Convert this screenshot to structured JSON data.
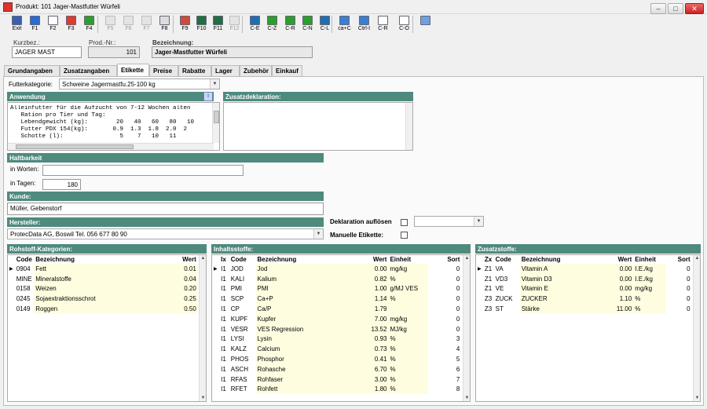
{
  "window": {
    "title": "Produkt: 101 Jager-Mastfutter Würfeli"
  },
  "toolbar": [
    {
      "label": "Exit",
      "icon": "exit-icon",
      "color": "#3a5fb0",
      "enabled": true
    },
    {
      "label": "F1",
      "icon": "help-icon",
      "color": "#2a6bd1",
      "enabled": true
    },
    {
      "label": "F2",
      "icon": "new-document-icon",
      "color": "#ffffff",
      "enabled": true
    },
    {
      "label": "F3",
      "icon": "delete-icon",
      "color": "#e03a2a",
      "enabled": true
    },
    {
      "label": "F4",
      "icon": "save-icon",
      "color": "#2aa02a",
      "enabled": true
    },
    {
      "label": "F5",
      "icon": "pin-icon",
      "color": "#cccccc",
      "enabled": false
    },
    {
      "label": "F6",
      "icon": "disabled-icon",
      "color": "#cccccc",
      "enabled": false
    },
    {
      "label": "F7",
      "icon": "disabled-icon",
      "color": "#cccccc",
      "enabled": false
    },
    {
      "label": "F8",
      "icon": "print-icon",
      "color": "#dddddd",
      "enabled": true
    },
    {
      "label": "F9",
      "icon": "copy-icon",
      "color": "#d04a3a",
      "enabled": true
    },
    {
      "label": "F10",
      "icon": "f10-icon",
      "color": "#1f6f3f",
      "enabled": true
    },
    {
      "label": "F11",
      "icon": "f11-icon",
      "color": "#1f6f3f",
      "enabled": true
    },
    {
      "label": "F12",
      "icon": "f12-icon",
      "color": "#cccccc",
      "enabled": false
    },
    {
      "label": "C-E",
      "icon": "first-record-icon",
      "color": "#1f6fb0",
      "enabled": true
    },
    {
      "label": "C-Z",
      "icon": "previous-record-icon",
      "color": "#2aa02a",
      "enabled": true
    },
    {
      "label": "C-R",
      "icon": "refresh-icon",
      "color": "#2aa02a",
      "enabled": true
    },
    {
      "label": "C-N",
      "icon": "next-record-icon",
      "color": "#2aa02a",
      "enabled": true
    },
    {
      "label": "C-L",
      "icon": "last-record-icon",
      "color": "#1f6fb0",
      "enabled": true
    },
    {
      "label": "ca+C",
      "icon": "copy-record-icon",
      "color": "#3a7fd0",
      "enabled": true
    },
    {
      "label": "Ctrl-I",
      "icon": "info-icon",
      "color": "#3a7fd0",
      "enabled": true
    },
    {
      "label": "C-R",
      "icon": "report-icon",
      "color": "#ffffff",
      "enabled": true
    },
    {
      "label": "C-O",
      "icon": "options-icon",
      "color": "#ffffff",
      "enabled": true
    },
    {
      "label": "",
      "icon": "mail-icon",
      "color": "#6fa0e0",
      "enabled": true
    }
  ],
  "header": {
    "kurzbez_label": "Kurzbez.:",
    "kurzbez_value": "JAGER MAST",
    "prodnr_label": "Prod.-Nr.:",
    "prodnr_value": "101",
    "bezeichnung_label": "Bezeichnung:",
    "bezeichnung_value": "Jager-Mastfutter Würfeli"
  },
  "tabs": [
    "Grundangaben",
    "Zusatzangaben",
    "Etikette",
    "Preise",
    "Rabatte",
    "Lager",
    "Zubehör",
    "Einkauf"
  ],
  "active_tab": "Etikette",
  "etikette": {
    "futterkategorie_label": "Futterkategorie:",
    "futterkategorie_value": "Schweine Jagermastfu.25-100 kg",
    "anwendung_title": "Anwendung",
    "anwendung_lines": [
      "Alleinfutter für die Aufzucht von 7-12 Wochen alten",
      "   Ration pro Tier und Tag:",
      "   Lebendgewicht (kg):        20   40   60   80   10",
      "   Futter PDX 154(kg):       0.9  1.3  1.8  2.0  2",
      "   Schotte (l):                5    7   10   11"
    ],
    "zusatzdeklaration_title": "Zusatzdeklaration:",
    "haltbarkeit_title": "Haltbarkeit",
    "in_worten_label": "in Worten:",
    "in_worten_value": "",
    "in_tagen_label": "in Tagen:",
    "in_tagen_value": "180",
    "kunde_title": "Kunde:",
    "kunde_value": "Müller, Gebenstorf",
    "hersteller_title": "Hersteller:",
    "hersteller_value": "ProtecData AG, Boswil Tel. 056 677 80 90",
    "deklaration_label": "Deklaration auflösen",
    "deklaration_checked": false,
    "manuelle_label": "Manuelle Etikette:",
    "manuelle_checked": false
  },
  "rohstoff": {
    "title": "Rohstoff-Kategorien:",
    "columns": [
      "Code",
      "Bezeichnung",
      "Wert"
    ],
    "rows": [
      [
        "0904",
        "Fett",
        "0.01"
      ],
      [
        "MINE",
        "Mineralstoffe",
        "0.04"
      ],
      [
        "0158",
        "Weizen",
        "0.20"
      ],
      [
        "0245",
        "Sojaextraktionsschrot",
        "0.25"
      ],
      [
        "0149",
        "Roggen",
        "0.50"
      ]
    ]
  },
  "inhaltsstoffe": {
    "title": "Inhaltsstoffe:",
    "columns": [
      "Ix",
      "Code",
      "Bezeichnung",
      "Wert",
      "Einheit",
      "Sort"
    ],
    "rows": [
      [
        "I1",
        "JOD",
        "Jod",
        "0.00",
        "mg/kg",
        "0"
      ],
      [
        "I1",
        "KALI",
        "Kalium",
        "0.82",
        "%",
        "0"
      ],
      [
        "I1",
        "PMI",
        "PMI",
        "1.00",
        "g/MJ VES",
        "0"
      ],
      [
        "I1",
        "SCP",
        "Ca+P",
        "1.14",
        "%",
        "0"
      ],
      [
        "I1",
        "CP",
        "Ca/P",
        "1.79",
        "",
        "0"
      ],
      [
        "I1",
        "KUPF",
        "Kupfer",
        "7.00",
        "mg/kg",
        "0"
      ],
      [
        "I1",
        "VESR",
        "VES Regression",
        "13.52",
        "MJ/kg",
        "0"
      ],
      [
        "I1",
        "LYSI",
        "Lysin",
        "0.93",
        "%",
        "3"
      ],
      [
        "I1",
        "KALZ",
        "Calcium",
        "0.73",
        "%",
        "4"
      ],
      [
        "I1",
        "PHOS",
        "Phosphor",
        "0.41",
        "%",
        "5"
      ],
      [
        "I1",
        "ASCH",
        "Rohasche",
        "6.70",
        "%",
        "6"
      ],
      [
        "I1",
        "RFAS",
        "Rohfaser",
        "3.00",
        "%",
        "7"
      ],
      [
        "I1",
        "RFET",
        "Rohfett",
        "1.80",
        "%",
        "8"
      ]
    ]
  },
  "zusatzstoffe": {
    "title": "Zusatzstoffe:",
    "columns": [
      "Zx",
      "Code",
      "Bezeichnung",
      "Wert",
      "Einheit",
      "Sort"
    ],
    "rows": [
      [
        "Z1",
        "VA",
        "Vitamin A",
        "0.00",
        "I.E./kg",
        "0"
      ],
      [
        "Z1",
        "VD3",
        "Vitamin D3",
        "0.00",
        "I.E./kg",
        "0"
      ],
      [
        "Z1",
        "VE",
        "Vitamin E",
        "0.00",
        "mg/kg",
        "0"
      ],
      [
        "Z3",
        "ZUCK",
        "ZUCKER",
        "1.10",
        "%",
        "0"
      ],
      [
        "Z3",
        "ST",
        "Stärke",
        "11.00",
        "%",
        "0"
      ]
    ]
  }
}
